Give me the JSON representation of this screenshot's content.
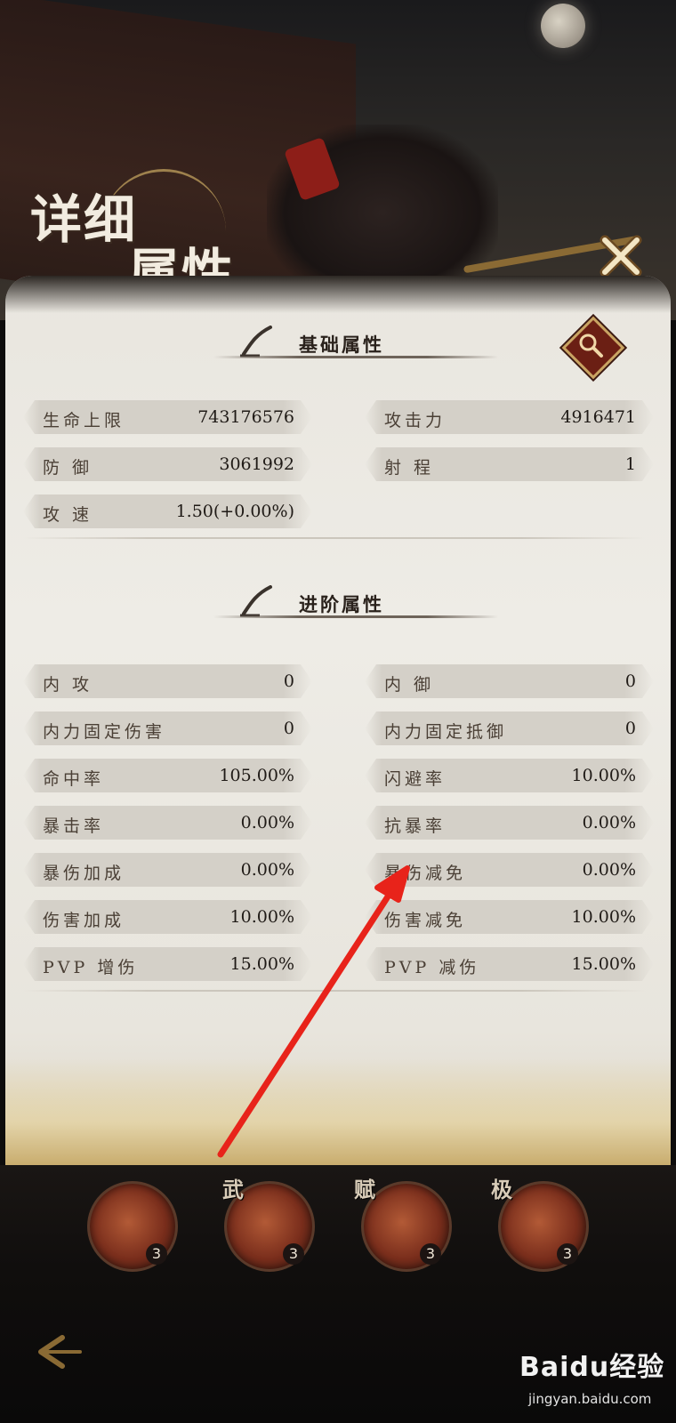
{
  "header": {
    "title_line1": "详细",
    "title_line2": "属性"
  },
  "basic_section": {
    "title": "基础属性",
    "stats": [
      {
        "name": "生命上限",
        "value": "743176576"
      },
      {
        "name": "攻击力",
        "value": "4916471"
      },
      {
        "name": "防 御",
        "value": "3061992"
      },
      {
        "name": "射 程",
        "value": "1"
      },
      {
        "name": "攻 速",
        "value": "1.50(+0.00%)"
      }
    ]
  },
  "advanced_section": {
    "title": "进阶属性",
    "stats": [
      {
        "name": "内 攻",
        "value": "0"
      },
      {
        "name": "内 御",
        "value": "0"
      },
      {
        "name": "内力固定伤害",
        "value": "0"
      },
      {
        "name": "内力固定抵御",
        "value": "0"
      },
      {
        "name": "命中率",
        "value": "105.00%"
      },
      {
        "name": "闪避率",
        "value": "10.00%"
      },
      {
        "name": "暴击率",
        "value": "0.00%"
      },
      {
        "name": "抗暴率",
        "value": "0.00%"
      },
      {
        "name": "暴伤加成",
        "value": "0.00%"
      },
      {
        "name": "暴伤减免",
        "value": "0.00%"
      },
      {
        "name": "伤害加成",
        "value": "10.00%"
      },
      {
        "name": "伤害减免",
        "value": "10.00%"
      },
      {
        "name": "PVP 增伤",
        "value": "15.00%"
      },
      {
        "name": "PVP 减伤",
        "value": "15.00%"
      }
    ]
  },
  "skills": [
    {
      "tag": "",
      "level": "3"
    },
    {
      "tag": "武",
      "level": "3"
    },
    {
      "tag": "赋",
      "level": "3"
    },
    {
      "tag": "极",
      "level": "3"
    }
  ],
  "watermark": {
    "brand": "Baidu经验",
    "site": "jingyan.baidu.com"
  },
  "icons": {
    "close": "close-icon",
    "search": "search-icon",
    "back": "back-arrow-icon"
  },
  "colors": {
    "panel": "#eeece6",
    "accent_gold": "#c9a463",
    "accent_red": "#6b1f14",
    "annotation_arrow": "#e8231a"
  }
}
